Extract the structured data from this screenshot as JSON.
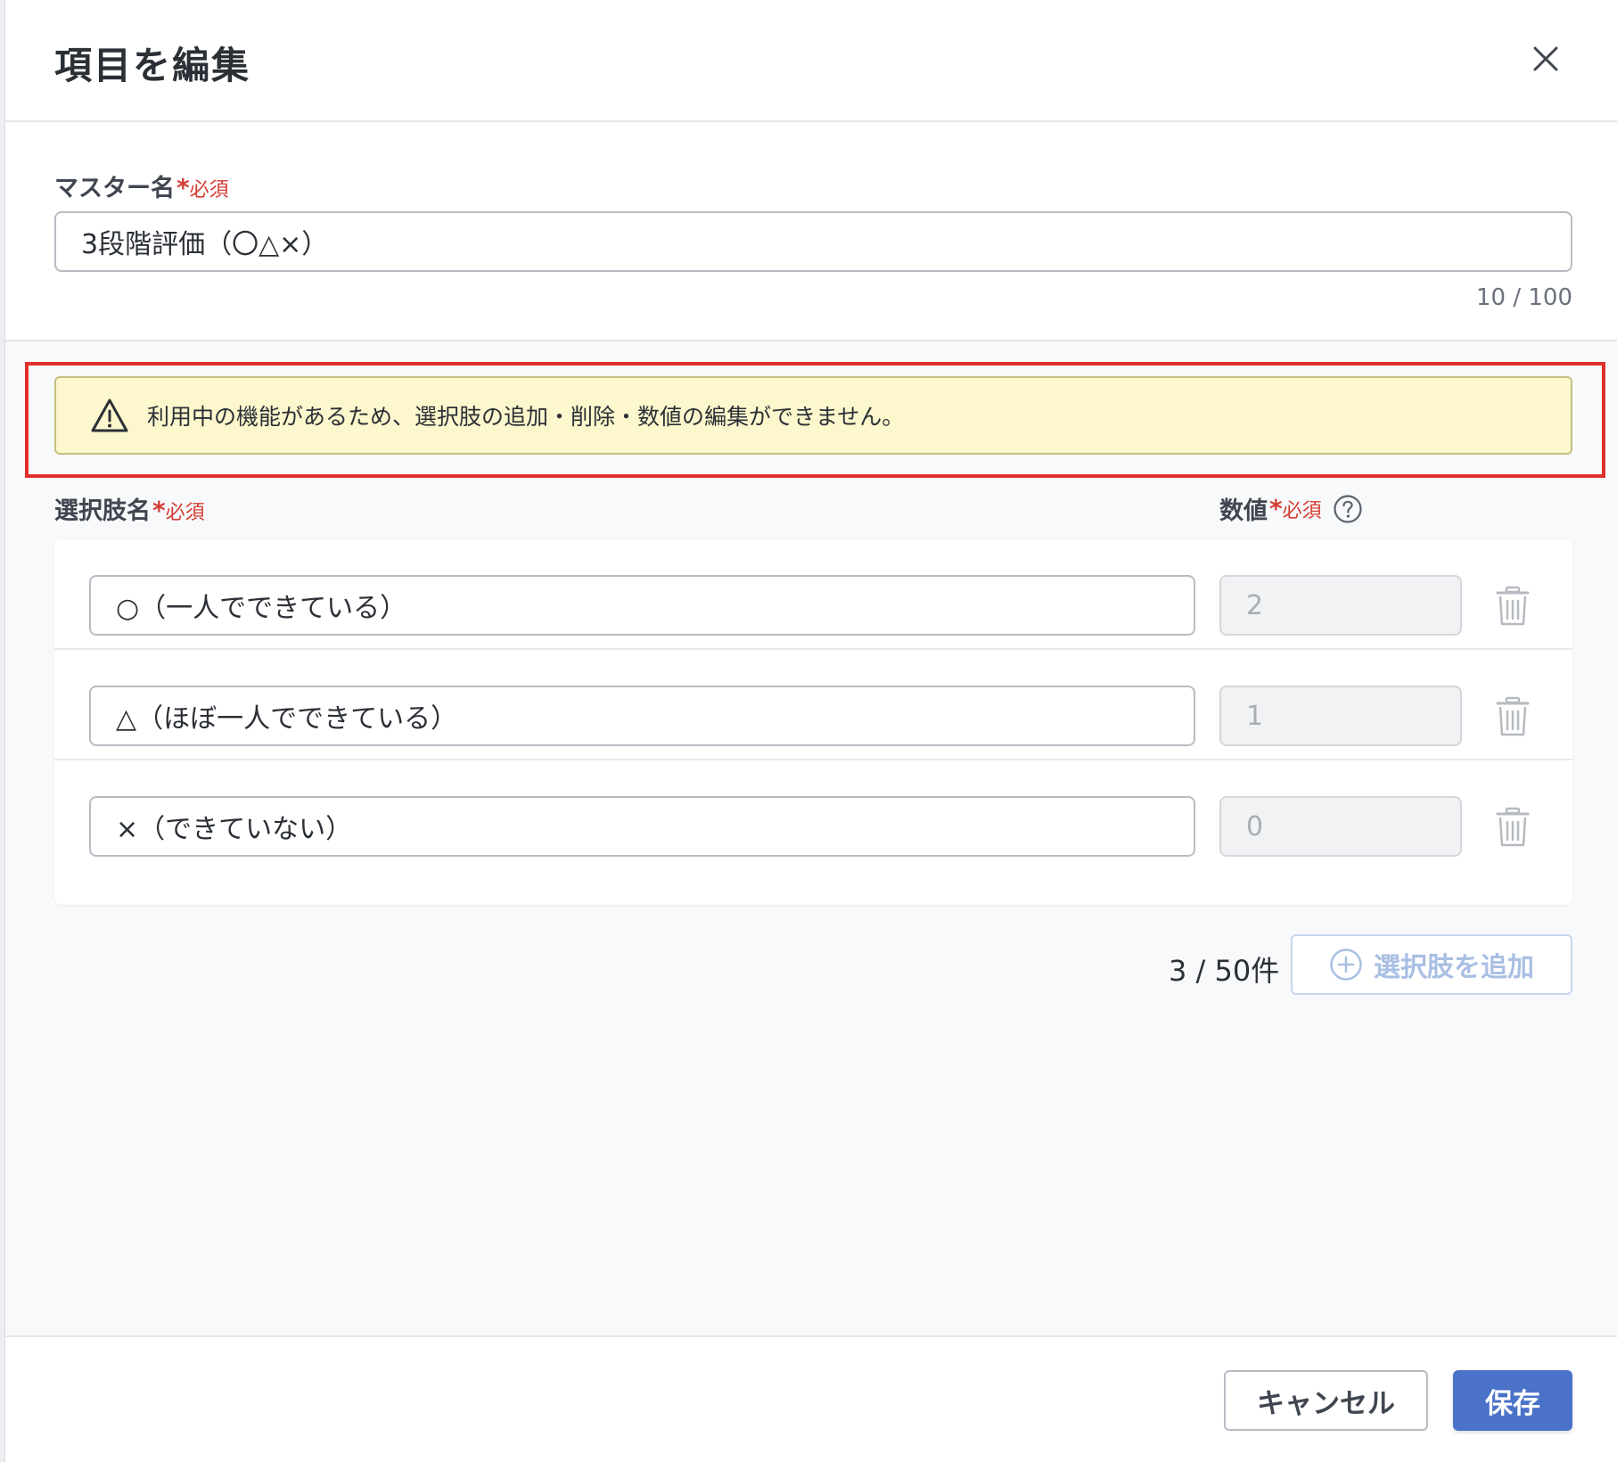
{
  "dialog": {
    "title": "項目を編集"
  },
  "master": {
    "label": "マスター名",
    "required_mark": "*",
    "required_text": "必須",
    "value": "3段階評価（〇△×）",
    "counter": "10 / 100"
  },
  "warning": {
    "icon": "warning-triangle-icon",
    "text": "利用中の機能があるため、選択肢の追加・削除・数値の編集ができません。"
  },
  "choices": {
    "name_label": "選択肢名",
    "value_label": "数値",
    "required_mark": "*",
    "required_text": "必須",
    "items": [
      {
        "name": "○（一人でできている）",
        "value": "2"
      },
      {
        "name": "△（ほぼ一人でできている）",
        "value": "1"
      },
      {
        "name": "×（できていない）",
        "value": "0"
      }
    ],
    "count": "3 / 50件",
    "add_label": "選択肢を追加"
  },
  "footer": {
    "cancel_label": "キャンセル",
    "save_label": "保存"
  },
  "colors": {
    "primary": "#4a72c9",
    "required": "#d43c33",
    "warning_bg": "#fcf7cc",
    "highlight": "#e0302b"
  }
}
